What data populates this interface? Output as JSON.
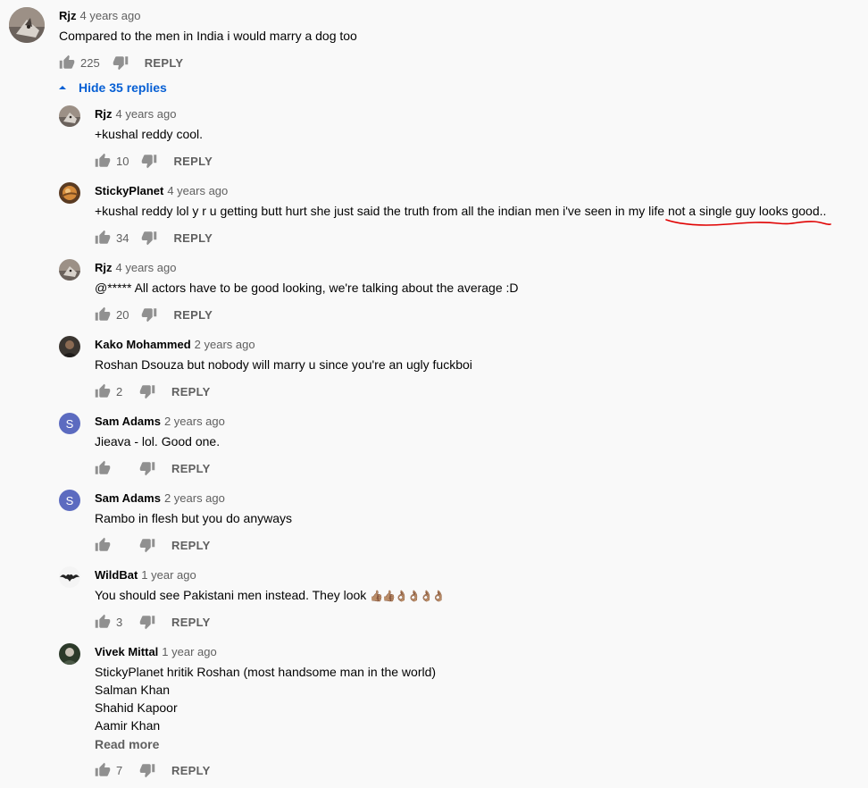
{
  "top_comment": {
    "author": "Rjz",
    "time": "4 years ago",
    "text": "Compared to the men in India i would marry a dog too",
    "likes": "225",
    "reply_label": "REPLY",
    "avatar_icon": "cat-avatar-icon"
  },
  "replies_toggle": {
    "label": "Hide 35 replies",
    "icon": "chevron-up-icon",
    "color": "#065fd4"
  },
  "replies": [
    {
      "author": "Rjz",
      "time": "4 years ago",
      "text": "+kushal reddy cool.",
      "likes": "10",
      "reply_label": "REPLY"
    },
    {
      "author": "StickyPlanet",
      "time": "4 years ago",
      "text": "+kushal reddy lol y r u getting butt hurt she just said the truth from all the indian men i've seen in my life not a single guy looks good..",
      "likes": "34",
      "reply_label": "REPLY"
    },
    {
      "author": "Rjz",
      "time": "4 years ago",
      "text": "@***** All actors have to be good looking, we're talking about the average :D",
      "likes": "20",
      "reply_label": "REPLY"
    },
    {
      "author": "Kako Mohammed",
      "time": "2 years ago",
      "text": "Roshan Dsouza but nobody will marry u since you're an ugly fuckboi",
      "likes": "2",
      "reply_label": "REPLY"
    },
    {
      "author": "Sam Adams",
      "time": "2 years ago",
      "text": "Jieava - lol. Good one.",
      "likes": "",
      "reply_label": "REPLY",
      "avatar_letter": "S"
    },
    {
      "author": "Sam Adams",
      "time": "2 years ago",
      "text": "Rambo in flesh but you do anyways",
      "likes": "",
      "reply_label": "REPLY",
      "avatar_letter": "S"
    },
    {
      "author": "WildBat",
      "time": "1 year ago",
      "text": "You should see Pakistani men instead. They look",
      "emoji": "👍🏽👍🏽👌🏽👌🏽👌🏽👌🏽",
      "likes": "3",
      "reply_label": "REPLY"
    },
    {
      "author": "Vivek Mittal",
      "time": "1 year ago",
      "lines": [
        "StickyPlanet hritik Roshan (most handsome man in the world)",
        "Salman Khan",
        "Shahid Kapoor",
        "Aamir Khan"
      ],
      "read_more": "Read more",
      "likes": "7",
      "reply_label": "REPLY"
    }
  ],
  "colors": {
    "link_blue": "#065fd4",
    "annotation_red": "#e00000",
    "letter_avatar": "#5c6bc0",
    "meta_grey": "#606060"
  }
}
